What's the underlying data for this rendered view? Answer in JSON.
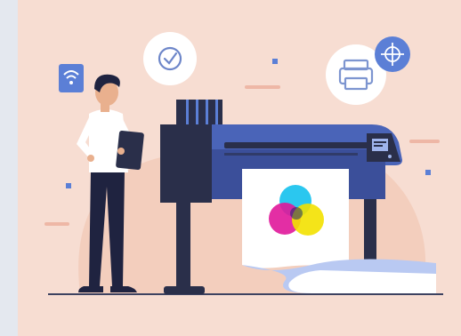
{
  "illustration": {
    "subject": "",
    "colors": {
      "background": "#f7ddd2",
      "outer_background": "#e4e8ef",
      "accent": "#5b7fd6",
      "printer_body": "#4a64b8",
      "printer_dark": "#2a2f4a",
      "paper": "#ffffff",
      "cmy_cyan": "#20c4ee",
      "cmy_magenta": "#e0179a",
      "cmy_yellow": "#f3e100"
    },
    "icons": [
      "wifi-icon",
      "check-clock-icon",
      "printer-icon",
      "crosshair-icon"
    ]
  }
}
